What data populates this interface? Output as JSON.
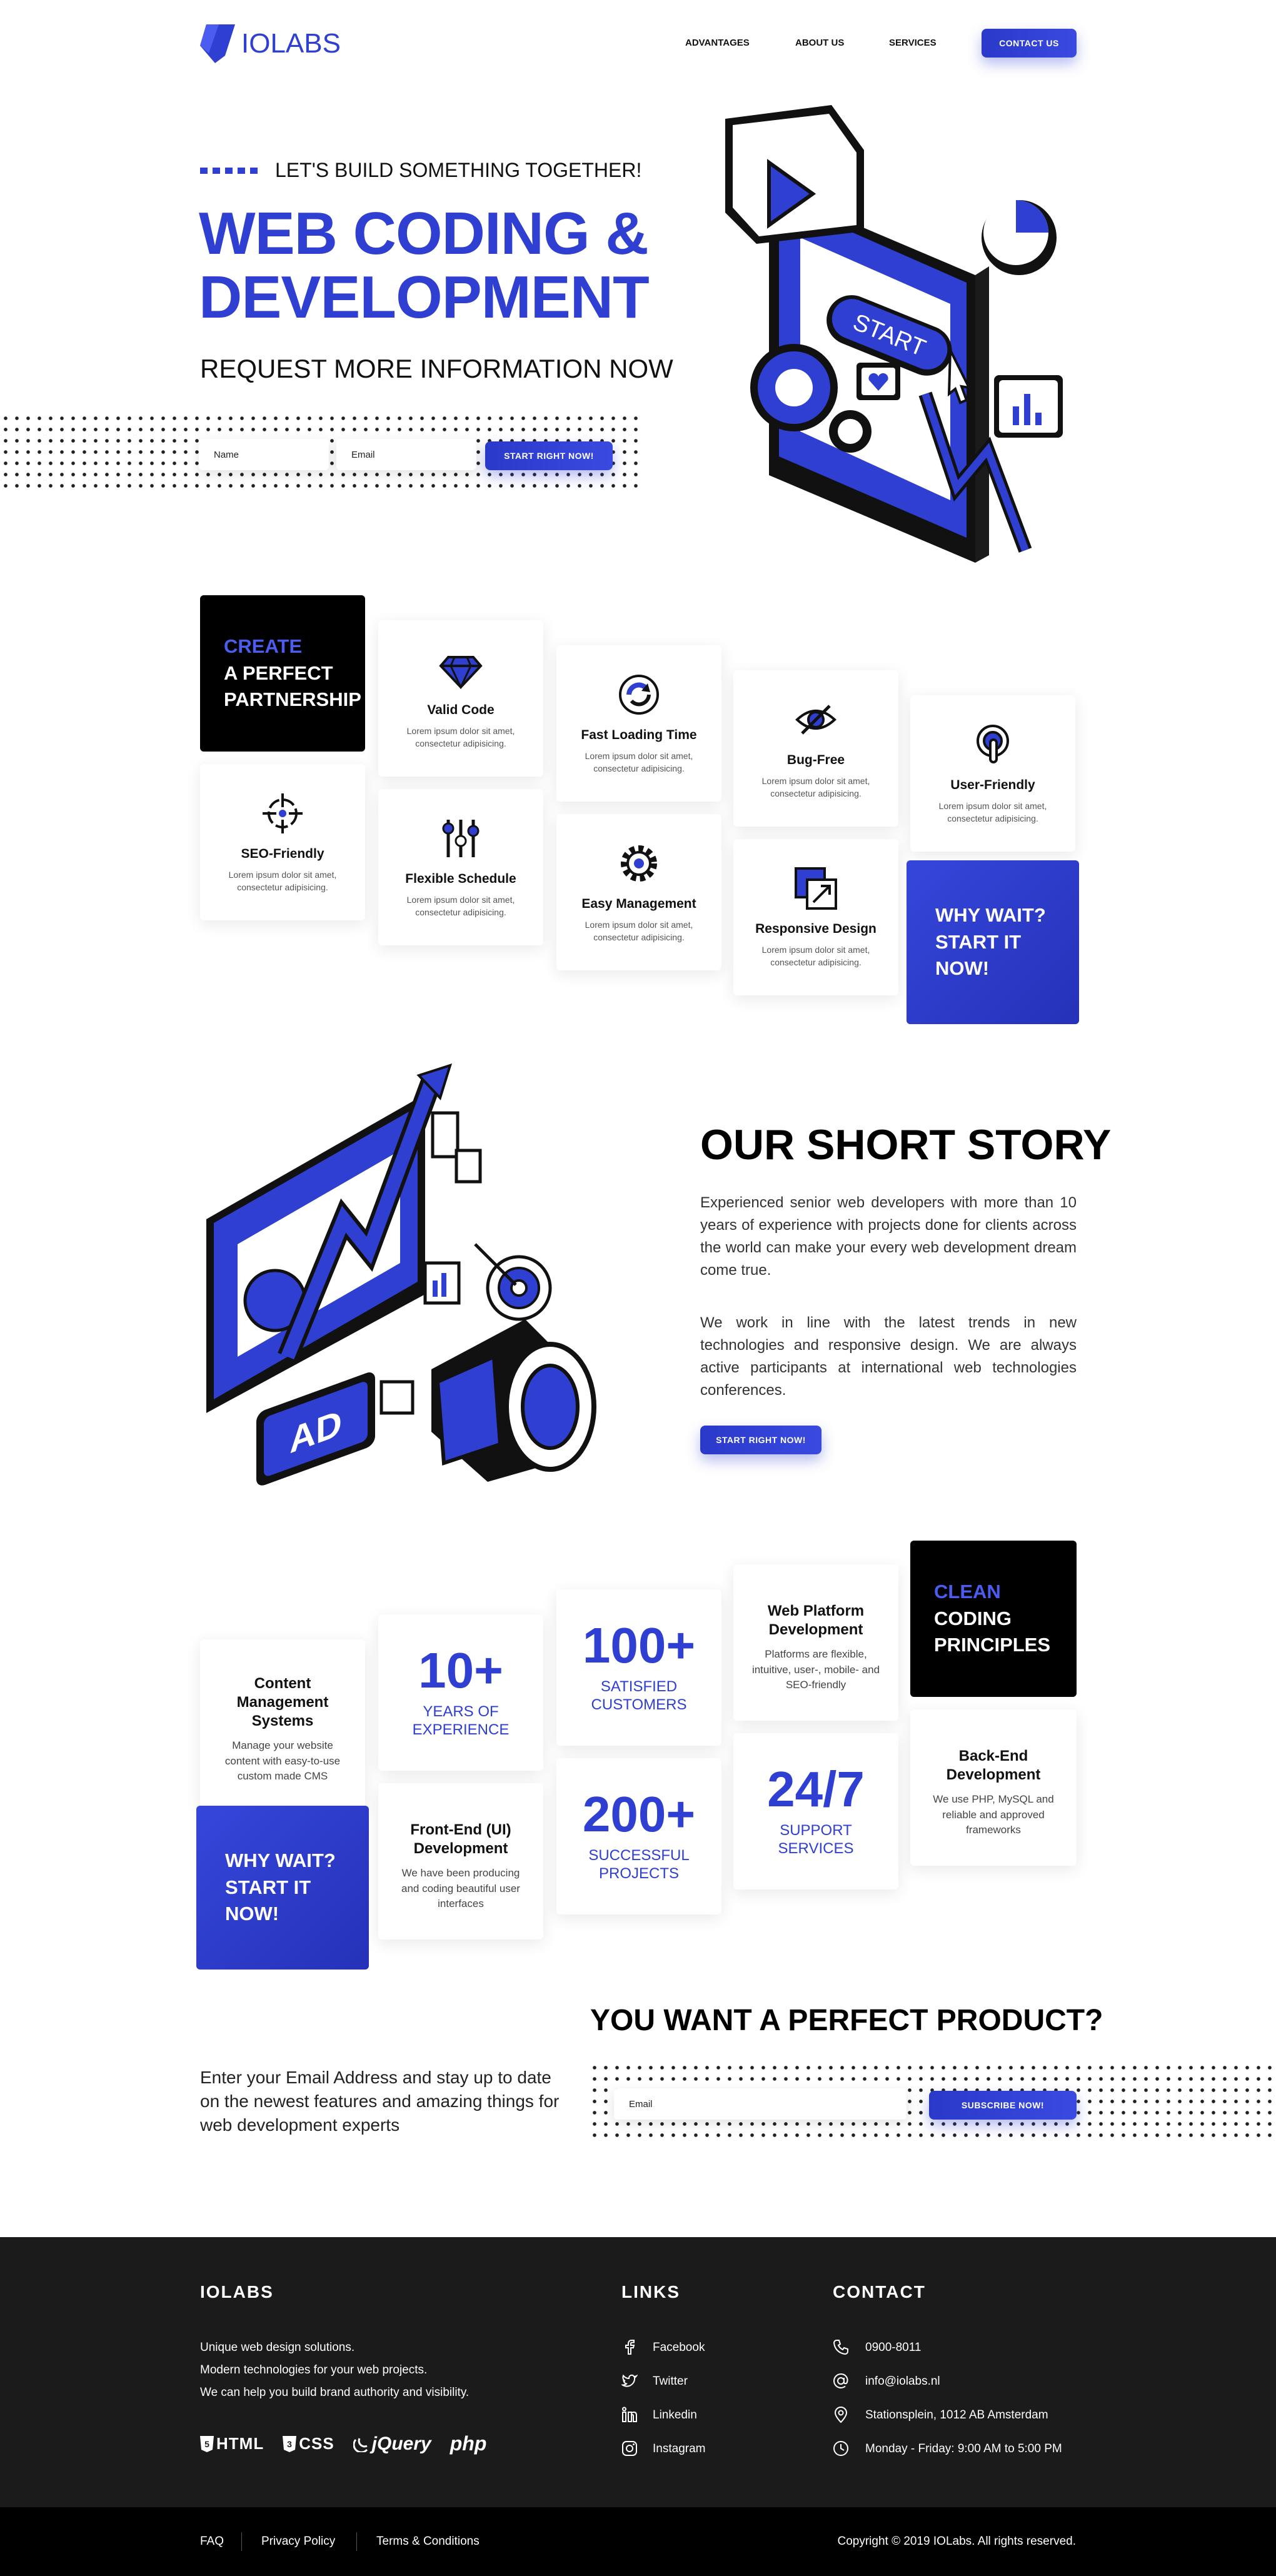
{
  "nav": {
    "logo_io": "IO",
    "logo_labs": "LABS",
    "items": [
      "ADVANTAGES",
      "ABOUT US",
      "SERVICES"
    ],
    "cta": "CONTACT US"
  },
  "hero": {
    "kicker": "LET'S BUILD SOMETHING TOGETHER!",
    "title_line1": "WEB CODING &",
    "title_line2": "DEVELOPMENT",
    "subtitle": "REQUEST MORE INFORMATION NOW",
    "name_placeholder": "Name",
    "email_placeholder": "Email",
    "submit": "START RIGHT NOW!",
    "illustration_label": "START"
  },
  "advantages": {
    "intro_line1": "CREATE",
    "intro_line2": "A PERFECT",
    "intro_line3": "PARTNERSHIP",
    "cards": [
      {
        "title": "Valid Code",
        "desc": "Lorem ipsum dolor sit amet, consectetur adipisicing.",
        "icon": "diamond-icon"
      },
      {
        "title": "Fast Loading Time",
        "desc": "Lorem ipsum dolor sit amet, consectetur adipisicing.",
        "icon": "refresh-icon"
      },
      {
        "title": "Bug-Free",
        "desc": "Lorem ipsum dolor sit amet, consectetur adipisicing.",
        "icon": "eye-slash-icon"
      },
      {
        "title": "User-Friendly",
        "desc": "Lorem ipsum dolor sit amet, consectetur adipisicing.",
        "icon": "touch-icon"
      },
      {
        "title": "SEO-Friendly",
        "desc": "Lorem ipsum dolor sit amet, consectetur adipisicing.",
        "icon": "crosshair-icon"
      },
      {
        "title": "Flexible Schedule",
        "desc": "Lorem ipsum dolor sit amet, consectetur adipisicing.",
        "icon": "sliders-icon"
      },
      {
        "title": "Easy Management",
        "desc": "Lorem ipsum dolor sit amet, consectetur adipisicing.",
        "icon": "gear-icon"
      },
      {
        "title": "Responsive Design",
        "desc": "Lorem ipsum dolor sit amet, consectetur adipisicing.",
        "icon": "resize-icon"
      }
    ],
    "cta_line1": "WHY WAIT?",
    "cta_line2": "START IT",
    "cta_line3": "NOW!"
  },
  "story": {
    "title": "OUR SHORT STORY",
    "para1": "Experienced senior web developers with more than 10 years of experience with projects done for clients across the world can make your every web development dream come true.",
    "para2": "We work in line with the latest trends in new technologies and responsive design. We are always active participants at international web technologies conferences.",
    "button": "START RIGHT NOW!",
    "illustration_label": "AD"
  },
  "services": {
    "cms_title": "Content Management Systems",
    "cms_desc": "Manage your website content with easy-to-use custom made CMS",
    "years_num": "10+",
    "years_label": "YEARS OF EXPERIENCE",
    "customers_num": "100+",
    "customers_label": "SATISFIED CUSTOMERS",
    "platform_title": "Web Platform Development",
    "platform_desc": "Platforms are flexible, intuitive, user-, mobile- and SEO-friendly",
    "clean_line1": "CLEAN",
    "clean_line2": "CODING",
    "clean_line3": "PRINCIPLES",
    "frontend_title": "Front-End (UI) Development",
    "frontend_desc": "We have been producing and coding beautiful user interfaces",
    "projects_num": "200+",
    "projects_label": "SUCCESSFUL PROJECTS",
    "support_num": "24/7",
    "support_label": "SUPPORT SERVICES",
    "backend_title": "Back-End Development",
    "backend_desc": "We use PHP, MySQL and reliable and approved frameworks",
    "cta_line1": "WHY WAIT?",
    "cta_line2": "START IT",
    "cta_line3": "NOW!"
  },
  "newsletter": {
    "title": "YOU WANT A PERFECT PRODUCT?",
    "text": "Enter your Email Address and stay up to date on the newest features and amazing things for web development experts",
    "email_placeholder": "Email",
    "button": "SUBSCRIBE NOW!"
  },
  "footer": {
    "brand_heading": "IOLABS",
    "brand_lines": [
      "Unique web design solutions.",
      "Modern technologies for your web projects.",
      "We can help you build brand authority and visibility."
    ],
    "tech_logos": [
      "HTML",
      "CSS",
      "jQuery",
      "php"
    ],
    "links_heading": "LINKS",
    "links": [
      "Facebook",
      "Twitter",
      "Linkedin",
      "Instagram"
    ],
    "contact_heading": "CONTACT",
    "contact": {
      "phone": "0900-8011",
      "email": "info@iolabs.nl",
      "address": "Stationsplein, 1012 AB Amsterdam",
      "hours": "Monday - Friday: 9:00 AM to 5:00 PM"
    },
    "bottom_links": [
      "FAQ",
      "Privacy Policy",
      "Terms & Conditions"
    ],
    "copyright": "Copyright © 2019 IOLabs. All rights reserved."
  }
}
